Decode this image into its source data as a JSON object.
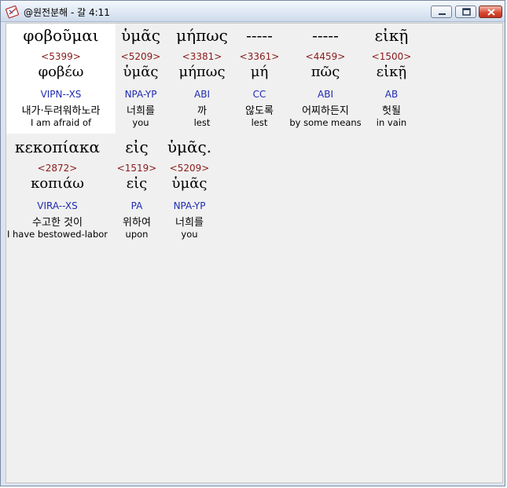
{
  "window": {
    "title": "@원전분해 - 갈 4:11",
    "icon": "bible-app-icon"
  },
  "rows": [
    {
      "words": [
        {
          "greek": "φοβοῦμαι",
          "strong": "<5399>",
          "lemma": "φοβέω",
          "morph": "VIPN--XS",
          "korean": "내가·두려워하노라",
          "english": "I am afraid of",
          "selected": true
        },
        {
          "greek": "ὑμᾶς",
          "strong": "<5209>",
          "lemma": "ὑμᾶς",
          "morph": "NPA-YP",
          "korean": "너희를",
          "english": "you"
        },
        {
          "greek": "μήπως",
          "strong": "<3381>",
          "lemma": "μήπως",
          "morph": "ABI",
          "korean": "까",
          "english": "lest"
        },
        {
          "greek": "-----",
          "strong": "<3361>",
          "lemma": "μή",
          "morph": "CC",
          "korean": "않도록",
          "english": "lest"
        },
        {
          "greek": "-----",
          "strong": "<4459>",
          "lemma": "πῶς",
          "morph": "ABI",
          "korean": "어찌하든지",
          "english": "by some means"
        },
        {
          "greek": "εἰκῇ",
          "strong": "<1500>",
          "lemma": "εἰκῇ",
          "morph": "AB",
          "korean": "헛될",
          "english": "in vain"
        }
      ]
    },
    {
      "words": [
        {
          "greek": "κεκοπίακα",
          "strong": "<2872>",
          "lemma": "κοπιάω",
          "morph": "VIRA--XS",
          "korean": "수고한 것이",
          "english": "I have bestowed-labor"
        },
        {
          "greek": "εἰς",
          "strong": "<1519>",
          "lemma": "εἰς",
          "morph": "PA",
          "korean": "위하여",
          "english": "upon"
        },
        {
          "greek": "ὑμᾶς.",
          "strong": "<5209>",
          "lemma": "ὑμᾶς",
          "morph": "NPA-YP",
          "korean": "너희를",
          "english": "you"
        }
      ]
    }
  ]
}
